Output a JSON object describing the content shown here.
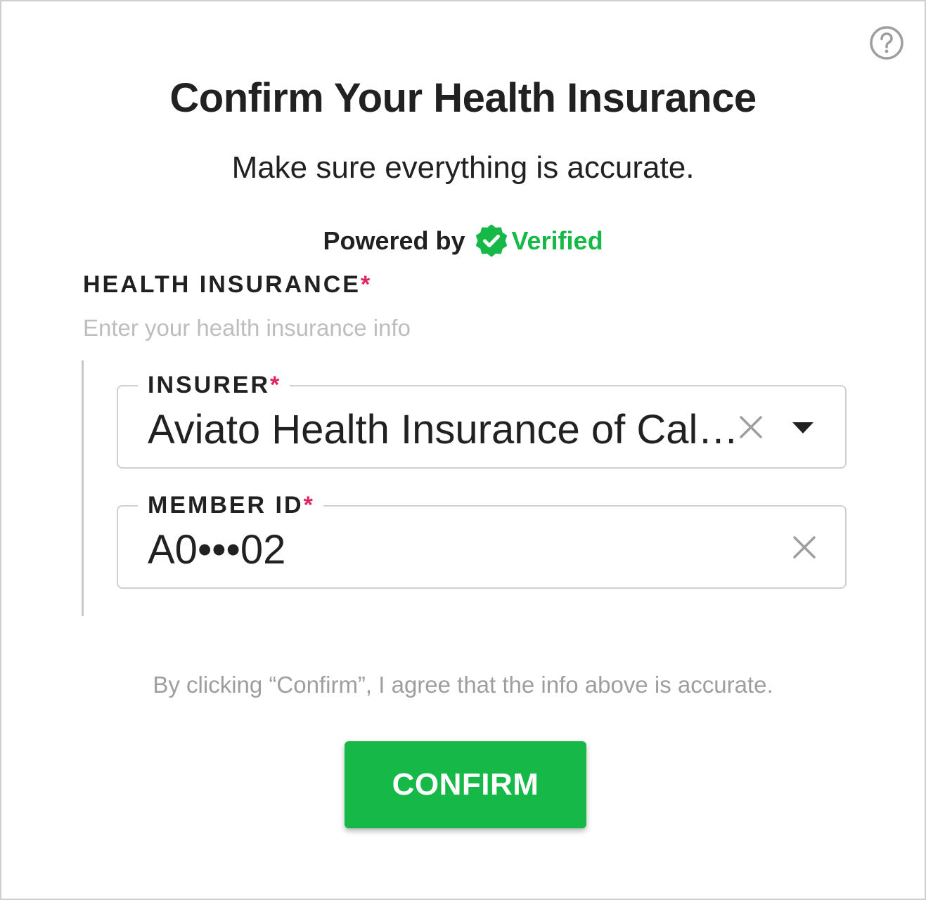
{
  "header": {
    "title": "Confirm Your Health Insurance",
    "subtitle": "Make sure everything is accurate.",
    "help_icon": "question-circle-icon"
  },
  "powered": {
    "prefix": "Powered by",
    "brand": "Verified",
    "badge_icon": "verified-check-badge-icon",
    "brand_color": "#16b847"
  },
  "section": {
    "label": "HEALTH INSURANCE",
    "required_mark": "*",
    "hint": "Enter your health insurance info"
  },
  "fields": {
    "insurer": {
      "label": "INSURER",
      "required_mark": "*",
      "value": "Aviato Health Insurance of Cal…",
      "clear_icon": "close-icon",
      "dropdown_icon": "caret-down-icon"
    },
    "member_id": {
      "label": "MEMBER ID",
      "required_mark": "*",
      "value": "A0•••02",
      "clear_icon": "close-icon"
    }
  },
  "footer": {
    "consent": "By clicking “Confirm”, I agree that the info above is accurate.",
    "confirm_label": "CONFIRM"
  },
  "colors": {
    "accent": "#16b847",
    "required": "#e0245e",
    "muted_text": "#9e9e9e",
    "border": "#d0d0d0"
  }
}
